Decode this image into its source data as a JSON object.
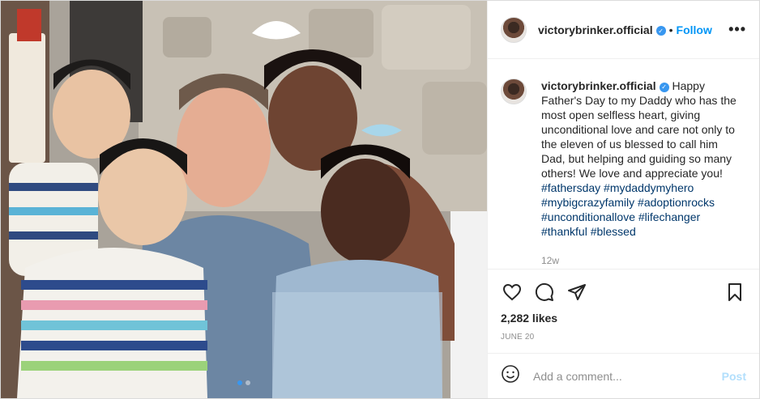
{
  "post": {
    "username": "victorybrinker.official",
    "follow_label": "Follow",
    "separator": "•",
    "more_icon": "more-options-icon",
    "caption_text": "Happy Father's Day to my Daddy who has the most open selfless heart, giving unconditional love and care not only to the eleven of us blessed to call him Dad, but helping and guiding so many others! We love and appreciate you!",
    "hashtags": "#fathersday #mydaddymyhero #mybigcrazyfamily #adoptionrocks #unconditionallove #lifechanger #thankful #blessed",
    "age": "12w",
    "likes": "2,282 likes",
    "date": "JUNE 20",
    "carousel_count": 2,
    "carousel_active": 1
  },
  "comment": {
    "placeholder": "Add a comment...",
    "post_label": "Post"
  },
  "icons": {
    "verified": "verified-badge-icon",
    "like": "heart-icon",
    "comment": "comment-icon",
    "share": "paper-plane-icon",
    "save": "bookmark-icon",
    "emoji": "emoji-icon"
  },
  "colors": {
    "accent": "#0095f6",
    "verified": "#3897f0",
    "hashtag": "#00376b",
    "muted": "#8e8e8e",
    "post_disabled": "#b2dffc"
  }
}
